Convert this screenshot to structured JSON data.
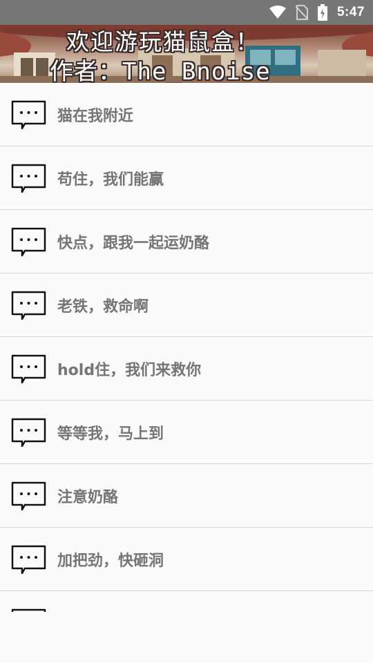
{
  "status_bar": {
    "time": "5:47",
    "icons": [
      "wifi-icon",
      "no-sim-icon",
      "battery-charging-icon"
    ]
  },
  "banner": {
    "line1": "欢迎游玩猫鼠盒！",
    "line2": "作者：The_Bnoise"
  },
  "list": {
    "item_icon": "chat-bubble-icon",
    "items": [
      {
        "label": "猫在我附近"
      },
      {
        "label": "苟住，我们能赢"
      },
      {
        "label": "快点，跟我一起运奶酪"
      },
      {
        "label": "老铁，救命啊"
      },
      {
        "label": "hold住，我们来救你"
      },
      {
        "label": "等等我，马上到"
      },
      {
        "label": "注意奶酪"
      },
      {
        "label": "加把劲，快砸洞"
      },
      {
        "label": ""
      }
    ]
  },
  "colors": {
    "status_bar": "#777777",
    "background": "#fafafa",
    "label_text": "#757575",
    "divider": "#d6d6d6"
  }
}
